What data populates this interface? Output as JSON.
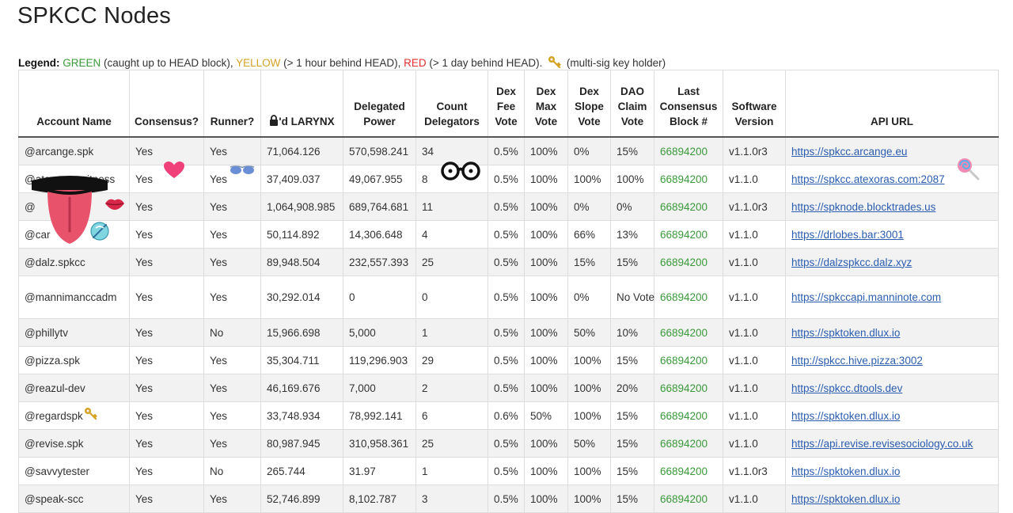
{
  "page": {
    "title": "SPKCC Nodes"
  },
  "legend": {
    "label": "Legend:",
    "green": "GREEN",
    "green_desc": " (caught up to HEAD block), ",
    "yellow": "YELLOW",
    "yellow_desc": " (> 1 hour behind HEAD), ",
    "red": "RED",
    "red_desc": " (> 1 day behind HEAD). ",
    "key_desc": " (multi-sig key holder)"
  },
  "colors": {
    "green": "#3a9a3a",
    "yellow": "#d4a325",
    "red": "#e03030",
    "link": "#2a5db0",
    "key": "#d4a325"
  },
  "table": {
    "headers": {
      "account": "Account Name",
      "consensus": "Consensus?",
      "runner": "Runner?",
      "larynx_suffix": "'d LARYNX",
      "delegated": "Delegated Power",
      "count": "Count Delegators",
      "fee": "Dex Fee Vote",
      "max": "Dex Max Vote",
      "slope": "Dex Slope Vote",
      "dao": "DAO Claim Vote",
      "block": "Last Consensus Block #",
      "version": "Software Version",
      "api": "API URL"
    },
    "rows": [
      {
        "account": "@arcange.spk",
        "consensus": "Yes",
        "runner": "Yes",
        "larynx": "71,064.126",
        "delegated": "570,598.241",
        "count": "34",
        "fee": "0.5%",
        "max": "100%",
        "slope": "0%",
        "dao": "15%",
        "block": "66894200",
        "version": "v1.1.0r3",
        "api": "https://spkcc.arcange.eu"
      },
      {
        "account": "@atexoras.witness",
        "consensus": "Yes",
        "runner": "Yes",
        "larynx": "37,409.037",
        "delegated": "49,067.955",
        "count": "8",
        "fee": "0.5%",
        "max": "100%",
        "slope": "100%",
        "dao": "100%",
        "block": "66894200",
        "version": "v1.1.0",
        "api": "https://spkcc.atexoras.com:2087"
      },
      {
        "account": "@",
        "consensus": "Yes",
        "runner": "Yes",
        "larynx": "1,064,908.985",
        "delegated": "689,764.681",
        "count": "11",
        "fee": "0.5%",
        "max": "100%",
        "slope": "0%",
        "dao": "0%",
        "block": "66894200",
        "version": "v1.1.0r3",
        "api": "https://spknode.blocktrades.us"
      },
      {
        "account": "@car",
        "consensus": "Yes",
        "runner": "Yes",
        "larynx": "50,114.892",
        "delegated": "14,306.648",
        "count": "4",
        "fee": "0.5%",
        "max": "100%",
        "slope": "66%",
        "dao": "13%",
        "block": "66894200",
        "version": "v1.1.0",
        "api": "https://drlobes.bar:3001"
      },
      {
        "account": "@dalz.spkcc",
        "consensus": "Yes",
        "runner": "Yes",
        "larynx": "89,948.504",
        "delegated": "232,557.393",
        "count": "25",
        "fee": "0.5%",
        "max": "100%",
        "slope": "15%",
        "dao": "15%",
        "block": "66894200",
        "version": "v1.1.0",
        "api": "https://dalzspkcc.dalz.xyz"
      },
      {
        "account": "@mannimanccadm",
        "consensus": "Yes",
        "runner": "Yes",
        "larynx": "30,292.014",
        "delegated": "0",
        "count": "0",
        "fee": "0.5%",
        "max": "100%",
        "slope": "0%",
        "dao": "No Vote",
        "block": "66894200",
        "version": "v1.1.0",
        "api": "https://spkccapi.manninote.com"
      },
      {
        "account": "@phillytv",
        "consensus": "Yes",
        "runner": "No",
        "larynx": "15,966.698",
        "delegated": "5,000",
        "count": "1",
        "fee": "0.5%",
        "max": "100%",
        "slope": "50%",
        "dao": "10%",
        "block": "66894200",
        "version": "v1.1.0",
        "api": "https://spktoken.dlux.io"
      },
      {
        "account": "@pizza.spk",
        "consensus": "Yes",
        "runner": "Yes",
        "larynx": "35,304.711",
        "delegated": "119,296.903",
        "count": "29",
        "fee": "0.5%",
        "max": "100%",
        "slope": "100%",
        "dao": "15%",
        "block": "66894200",
        "version": "v1.1.0",
        "api": "http://spkcc.hive.pizza:3002"
      },
      {
        "account": "@reazul-dev",
        "consensus": "Yes",
        "runner": "Yes",
        "larynx": "46,169.676",
        "delegated": "7,000",
        "count": "2",
        "fee": "0.5%",
        "max": "100%",
        "slope": "100%",
        "dao": "20%",
        "block": "66894200",
        "version": "v1.1.0",
        "api": "https://spkcc.dtools.dev"
      },
      {
        "account": "@regardspk",
        "consensus": "Yes",
        "runner": "Yes",
        "larynx": "33,748.934",
        "delegated": "78,992.141",
        "count": "6",
        "fee": "0.6%",
        "max": "50%",
        "slope": "100%",
        "dao": "15%",
        "block": "66894200",
        "version": "v1.1.0",
        "api": "https://spktoken.dlux.io"
      },
      {
        "account": "@revise.spk",
        "consensus": "Yes",
        "runner": "Yes",
        "larynx": "80,987.945",
        "delegated": "310,958.361",
        "count": "25",
        "fee": "0.5%",
        "max": "100%",
        "slope": "50%",
        "dao": "15%",
        "block": "66894200",
        "version": "v1.1.0",
        "api": "https://api.revise.revisesociology.co.uk"
      },
      {
        "account": "@savvytester",
        "consensus": "Yes",
        "runner": "No",
        "larynx": "265.744",
        "delegated": "31.97",
        "count": "1",
        "fee": "0.5%",
        "max": "100%",
        "slope": "100%",
        "dao": "15%",
        "block": "66894200",
        "version": "v1.1.0r3",
        "api": "https://spktoken.dlux.io"
      },
      {
        "account": "@speak-scc",
        "consensus": "Yes",
        "runner": "Yes",
        "larynx": "52,746.899",
        "delegated": "8,102.787",
        "count": "3",
        "fee": "0.5%",
        "max": "100%",
        "slope": "100%",
        "dao": "15%",
        "block": "66894200",
        "version": "v1.1.0",
        "api": "https://spktoken.dlux.io"
      }
    ]
  }
}
